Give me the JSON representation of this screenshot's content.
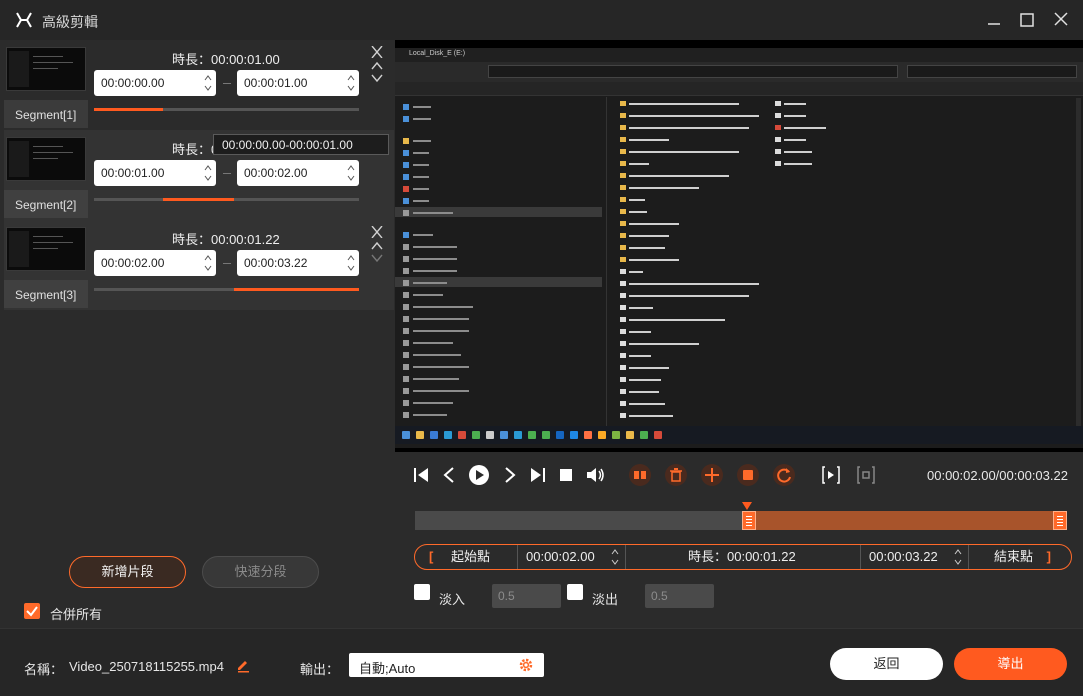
{
  "window": {
    "title": "高級剪輯"
  },
  "segments": [
    {
      "label": "Segment[1]",
      "duration": "時長：00:00:01.00",
      "start": "00:00:00.00",
      "end": "00:00:01.00",
      "fill_start": 0.0,
      "fill_end": 0.26
    },
    {
      "label": "Segment[2]",
      "duration": "時長：00:00:01.00",
      "start": "00:00:01.00",
      "end": "00:00:02.00",
      "fill_start": 0.26,
      "fill_end": 0.53
    },
    {
      "label": "Segment[3]",
      "duration": "時長：00:00:01.22",
      "start": "00:00:02.00",
      "end": "00:00:03.22",
      "fill_start": 0.53,
      "fill_end": 1.0
    }
  ],
  "tooltip": "00:00:00.00-00:00:01.00",
  "left_actions": {
    "add_segment": "新增片段",
    "quick_split": "快速分段",
    "merge_all": "合併所有"
  },
  "player": {
    "timecode": "00:00:02.00/00:00:03.22"
  },
  "range": {
    "start_label": "起始點",
    "start_time": "00:00:02.00",
    "duration": "時長：00:00:01.22",
    "end_time": "00:00:03.22",
    "end_label": "結束點",
    "bracket_open": "[",
    "bracket_close": "]"
  },
  "fade": {
    "in_label": "淡入",
    "in_value": "0.5",
    "out_label": "淡出",
    "out_value": "0.5"
  },
  "bottom": {
    "name_label": "名稱：",
    "name_value": "Video_250718115255.mp4",
    "output_label": "輸出：",
    "output_value": "自動;Auto",
    "back": "返回",
    "export": "導出"
  },
  "preview_screen": {
    "tab_title": "Local_Disk_E (E:)"
  },
  "colors": {
    "accent": "#ff5a1f",
    "background": "#2b2b2b"
  }
}
